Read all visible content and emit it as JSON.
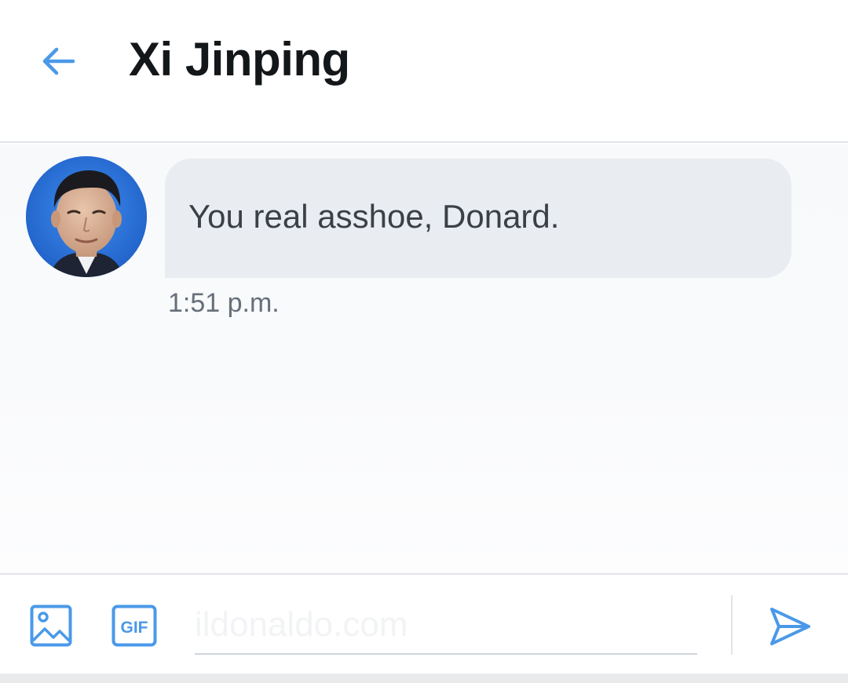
{
  "header": {
    "title": "Xi Jinping",
    "back_icon": "arrow-left-icon"
  },
  "conversation": {
    "messages": [
      {
        "avatar": "user-avatar-photo",
        "text": "You real asshoe, Donard.",
        "time": "1:51 p.m."
      }
    ]
  },
  "composer": {
    "media_icon": "image-icon",
    "gif_icon": "gif-icon",
    "gif_label": "GIF",
    "placeholder": "ildonaldo.com",
    "value": "",
    "send_icon": "send-icon"
  },
  "colors": {
    "accent": "#4a99e9",
    "bubble": "#e9ecf0",
    "title": "#14171a",
    "timestamp": "#666f79"
  }
}
